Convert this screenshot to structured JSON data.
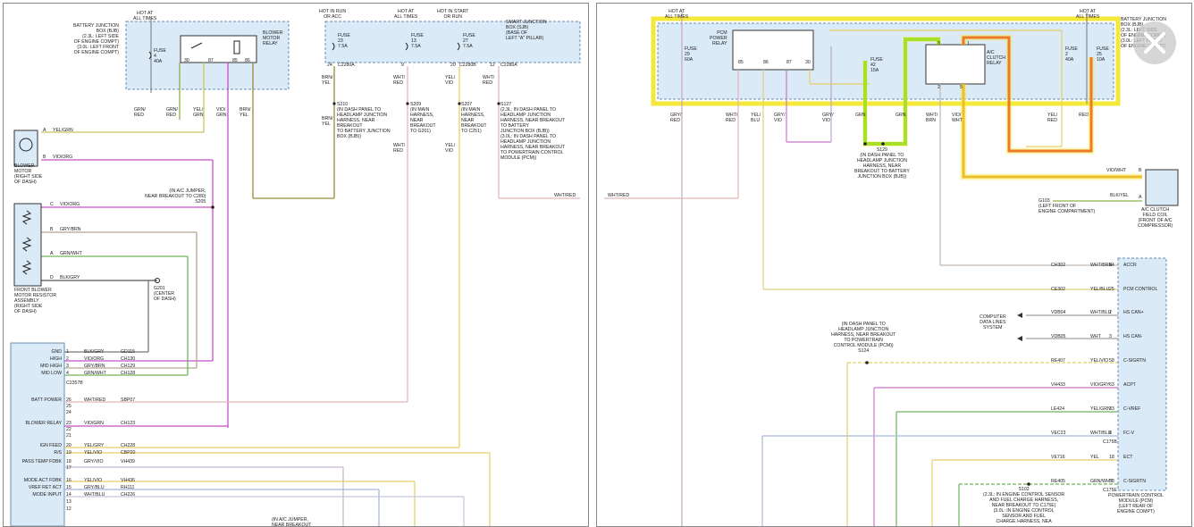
{
  "left": {
    "hot_all_times": "HOT AT\nALL TIMES",
    "bjb_label": "BATTERY JUNCTION\nBOX (BJB)\n(2.3L: LEFT SIDE\nOF ENGINE COMPT)\n(3.0L: LEFT FRONT\nOF ENGINE COMPT)",
    "fuse4": "FUSE\n4\n40A",
    "blower_relay": "BLOWER\nMOTOR\nRELAY",
    "relay_pins": [
      "30",
      "87",
      "85",
      "86"
    ],
    "w_grn_red1": "GRN/\nRED",
    "w_grn_red2": "GRN/\nRED",
    "w_yel_grn": "YEL/\nGRN",
    "w_vio_grn": "VIO/\nGRN",
    "w_brn_yel": "BRN/\nYEL",
    "hot_run_acc": "HOT IN RUN\nOR ACC",
    "hot_all_times2": "HOT AT\nALL TIMES",
    "hot_start_run": "HOT IN START\nOR RUN",
    "sjb_label": "SMART JUNCTION\nBOX (SJB)\n(BASE OF\nLEFT \"A\" PILLAR)",
    "fuse23": "FUSE\n23\n7.5A",
    "fuse13": "FUSE\n13\n7.5A",
    "fuse27": "FUSE\n27\n7.5A",
    "pin24": "24",
    "c2280a1": "C2280A",
    "pin9": "9",
    "pin20": "20",
    "c2280b": "C2280B",
    "pin12": "12",
    "c2280a2": "C2280A",
    "w_brn_yel2": "BRN/\nYEL",
    "w_wht_red": "WHT/\nRED",
    "w_yel_vio": "YEL/\nVIO",
    "w_wht_red2": "WHT/\nRED",
    "s210": "S210\n(IN DASH PANEL TO\nHEADLAMP JUNCTION\nHARNESS, NEAR\nBREAKOUT\nTO BATTERY JUNCTION\nBOX (BJB))",
    "s209": "S209\n(IN MAIN\nHARNESS,\nNEAR\nBREAKOUT\nTO G201)",
    "s207": "S207\n(IN MAIN\nHARNESS,\nNEAR\nBREAKOUT\nTO C251)",
    "s127": "S127\n(2.3L: IN DASH PANEL TO\nHEADLAMP JUNCTION\nHARNESS, NEAR BREAKOUT\nTO BATTERY\nJUNCTION BOX (BJB))\n(3.0L: IN DASH PANEL TO\nHEADLAMP JUNCTION\nHARNESS, NEAR BREAKOUT\nTO POWERTRAIN CONTROL\nMODULE (PCM))",
    "w_brn_yel3": "BRN/\nYEL",
    "w_wht_red3": "WHT/\nRED",
    "w_yel_vio3": "YEL/\nVIO",
    "w_wht_red_end": "WHT/RED",
    "blower_motor": "BLOWER\nMOTOR\n(RIGHT SIDE\nOF DASH)",
    "bm_a": "A",
    "bm_a_wire": "YEL/GRN",
    "bm_b": "B",
    "bm_b_wire": "VIO/ORG",
    "s205": "(IN A/C JUMPER,\nNEAR BREAKOUT TO C280)\nS205",
    "res_c": "C",
    "res_c_wire": "VIO/ORG",
    "res_b": "B",
    "res_b_wire": "GRY/BRN",
    "res_a": "A",
    "res_a_wire": "GRN/WHT",
    "res_d": "D",
    "res_d_wire": "BLK/GRY",
    "resistor": "FRONT BLOWER\nMOTOR RESISTOR\nASSEMBLY\n(RIGHT SIDE\nOF DASH)",
    "g201": "G201\n(CENTER\nOF DASH)",
    "module_rows": [
      {
        "label": "GND",
        "pin": "1",
        "wire": "BLK/GRY",
        "circuit": "GD115"
      },
      {
        "label": "HIGH",
        "pin": "2",
        "wire": "VIO/ORG",
        "circuit": "CH130"
      },
      {
        "label": "MID HIGH",
        "pin": "3",
        "wire": "GRY/BRN",
        "circuit": "CH129"
      },
      {
        "label": "MID LOW",
        "pin": "4",
        "wire": "GRN/WHT",
        "circuit": "CH128"
      },
      {
        "label": "BATT POWER",
        "pin": "26",
        "wire": "WHT/RED",
        "circuit": "SBP07"
      },
      {
        "label": "",
        "pin": "25",
        "wire": "",
        "circuit": ""
      },
      {
        "label": "",
        "pin": "24",
        "wire": "",
        "circuit": ""
      },
      {
        "label": "BLOWER RELAY",
        "pin": "23",
        "wire": "VIO/GRN",
        "circuit": "CH123"
      },
      {
        "label": "",
        "pin": "22",
        "wire": "",
        "circuit": ""
      },
      {
        "label": "",
        "pin": "21",
        "wire": "",
        "circuit": ""
      },
      {
        "label": "IGN FEED",
        "pin": "20",
        "wire": "YEL/GRY",
        "circuit": "CH228"
      },
      {
        "label": "R/S",
        "pin": "19",
        "wire": "YEL/VIO",
        "circuit": "CBP20"
      },
      {
        "label": "PASS TEMP FDBK",
        "pin": "18",
        "wire": "GRY/VIO",
        "circuit": "VH439"
      },
      {
        "label": "",
        "pin": "17",
        "wire": "",
        "circuit": ""
      },
      {
        "label": "MODE ACT FDBK",
        "pin": "16",
        "wire": "YEL/VIO",
        "circuit": "VH436"
      },
      {
        "label": "VREF RET ACT",
        "pin": "15",
        "wire": "GRY/BLU",
        "circuit": "RH111"
      },
      {
        "label": "MODE INPUT",
        "pin": "14",
        "wire": "WHT/BLU",
        "circuit": "CH226"
      },
      {
        "label": "",
        "pin": "13",
        "wire": "",
        "circuit": ""
      },
      {
        "label": "",
        "pin": "12",
        "wire": "",
        "circuit": ""
      }
    ],
    "c2357b": "C2357B",
    "ac_jumper_bottom": "(IN A/C JUMPER,\nNEAR BREAKOUT"
  },
  "right": {
    "hot_all_times_l": "HOT AT\nALL TIMES",
    "hot_all_times_r": "HOT AT\nALL TIMES",
    "fuse29": "FUSE\n29\n60A",
    "pcm_relay": "PCM\nPOWER\nRELAY",
    "pcm_relay_pins": [
      "85",
      "86",
      "87",
      "30"
    ],
    "fuse42": "FUSE\n42\n15A",
    "ac_relay": "A/C\nCLUTCH\nRELAY",
    "ac_pins": [
      "3",
      "1",
      "2",
      "5"
    ],
    "fuse2": "FUSE\n2\n40A",
    "fuse25": "FUSE\n25\n10A",
    "bjb_label": "BATTERY JUNCTION\nBOX (BJB)\n(2.3L: LEFT SIDE\nOF ENGINE COMPT)\n(3.0L: LEFT FRONT\nOF ENGINE COMPT)",
    "w_gry_red": "GRY/\nRED",
    "w_wht_red": "WHT/\nRED",
    "w_yel_blu": "YEL/\nBLU",
    "w_gry_vio": "GRY/\nVIO",
    "w_gry_vio2": "GRY/\nVIO",
    "w_grn": "GRN",
    "w_grn2": "GRN",
    "w_wht_brn": "WHT/\nBRN",
    "w_vio_wht": "VIO/\nWHT",
    "w_yel_red": "YEL/\nRED",
    "w_red": "RED",
    "s129": "S129\n(IN DASH PANEL TO\nHEADLAMP JUNCTION\nHARNESS, NEAR\nBREAKOUT TO BATTERY\nJUNCTION BOX (BJB))",
    "w_vio_wht2": "VIO/WHT",
    "pin_b": "B",
    "pin_a": "A",
    "w_blk_yel": "BLK/YEL",
    "g103": "G103\n(LEFT FRONT OF\nENGINE COMPARTMENT)",
    "clutch": "A/C CLUTCH\nFIELD COIL\n(FRONT OF A/C\nCOMPRESSOR)",
    "w_wht_red_left": "WHT/RED",
    "pcm_rows": [
      {
        "circuit": "CH302",
        "wire": "WHT/BRN",
        "pin": "64",
        "label": "ACCR"
      },
      {
        "circuit": "CE302",
        "wire": "YEL/BLU",
        "pin": "25",
        "label": "PCM CONTROL"
      },
      {
        "circuit": "VDB04",
        "wire": "WHT/BLU",
        "pin": "2",
        "label": "HS CAN+"
      },
      {
        "circuit": "VDB05",
        "wire": "WHT",
        "pin": "3",
        "label": "HS CAN-"
      },
      {
        "circuit": "RE407",
        "wire": "YEL/VIO",
        "pin": "58",
        "label": "C-SIGRTN"
      },
      {
        "circuit": "VH433",
        "wire": "VIO/GRY",
        "pin": "63",
        "label": "ACPT"
      },
      {
        "circuit": "LE424",
        "wire": "YEL/GRN",
        "pin": "33",
        "label": "C-VREF"
      },
      {
        "circuit": "VEC23",
        "wire": "WHT/BLU",
        "pin": "8",
        "label": "FC-V"
      },
      {
        "circuit": "VE716",
        "wire": "YEL",
        "pin": "18",
        "label": "ECT"
      },
      {
        "circuit": "RE405",
        "wire": "GRN/WHT",
        "pin": "58",
        "label": "C-SIGRTN"
      }
    ],
    "c175b": "C175B",
    "c175e": "C175E",
    "data_lines": "COMPUTER\nDATA LINES\nSYSTEM",
    "s124": "(IN DASH PANEL TO\nHEADLAMP JUNCTION\nHARNESS, NEAR BREAKOUT\nTO POWERTRAIN\nCONTROL MODULE (PCM))\nS124",
    "s102": "S102\n(2.3L: IN ENGINE CONTROL SENSOR\nAND FUEL CHARGE HARNESS,\nNEAR BREAKOUT TO C175E)\n(3.0L: IN ENGINE CONTROL\nSENSOR AND FUEL\nCHARGE HARNESS, NEA",
    "pcm_label": "POWERTRAIN CONTROL\nMODULE (PCM)\n(LEFT REAR OF\nENGINE COMPT)"
  },
  "colors": {
    "box_fill": "#dbeaf7",
    "highlight_yellow": "#f5e83a",
    "highlight_red": "#e8321a",
    "highlight_green": "#7ddc1f",
    "close_button": "#c8c8c8"
  },
  "icons": [
    "close-icon",
    "motor-icon",
    "coil-icon",
    "ground-icon"
  ]
}
